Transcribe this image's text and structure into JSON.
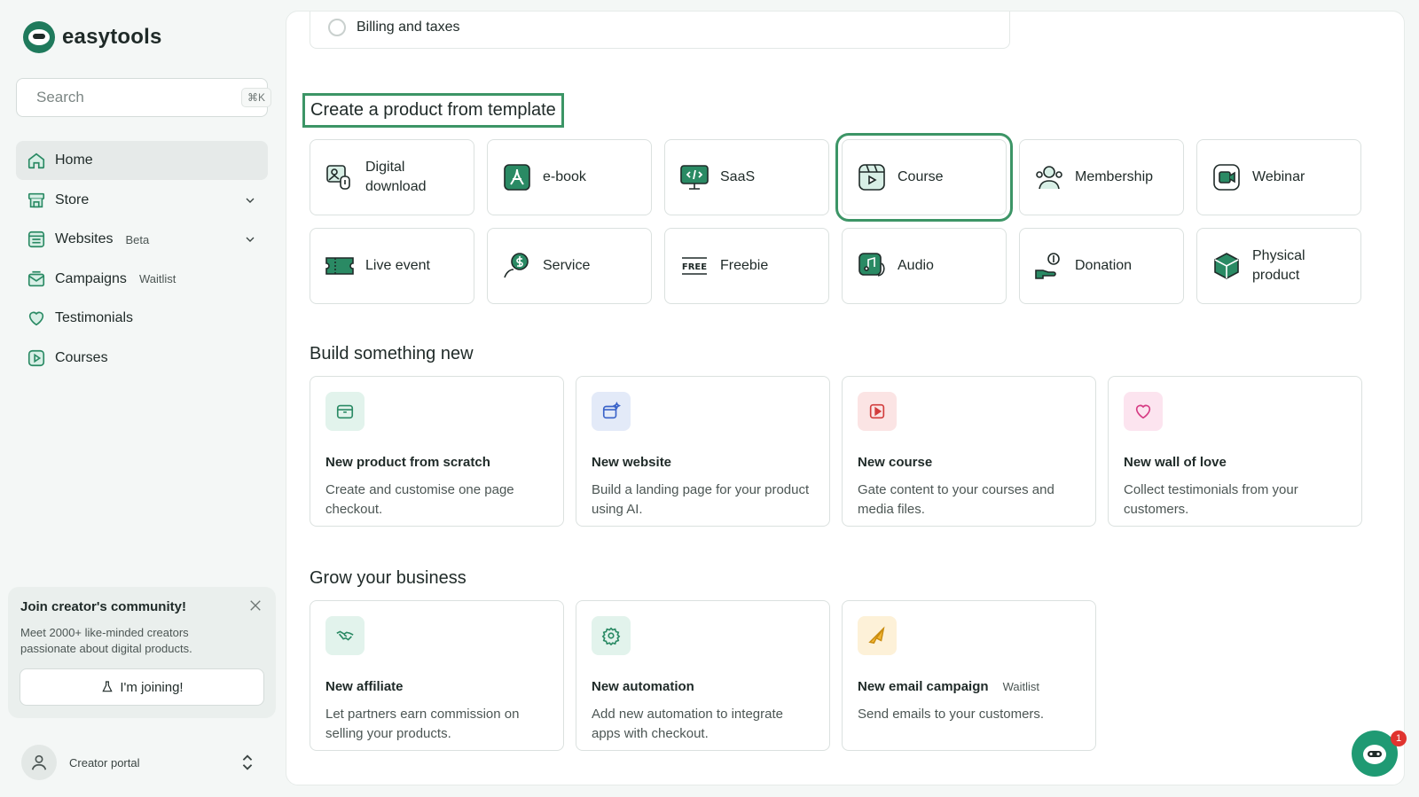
{
  "app": {
    "name": "easytools"
  },
  "search": {
    "placeholder": "Search",
    "shortcut": "⌘K"
  },
  "nav": {
    "items": [
      {
        "label": "Home",
        "badge": "",
        "icon": "home-icon"
      },
      {
        "label": "Store",
        "badge": "",
        "icon": "store-icon"
      },
      {
        "label": "Websites",
        "badge": "Beta",
        "icon": "websites-icon"
      },
      {
        "label": "Campaigns",
        "badge": "Waitlist",
        "icon": "campaigns-icon"
      },
      {
        "label": "Testimonials",
        "badge": "",
        "icon": "heart-icon"
      },
      {
        "label": "Courses",
        "badge": "",
        "icon": "play-icon"
      }
    ]
  },
  "community": {
    "title": "Join creator's community!",
    "text": "Meet 2000+ like-minded creators passionate about digital products.",
    "button": "I'm joining!"
  },
  "portal": {
    "label": "Creator portal"
  },
  "billing": {
    "label": "Billing and taxes"
  },
  "templates": {
    "title": "Create a product from template",
    "items": [
      {
        "label": "Digital download",
        "icon": "digital-download-icon"
      },
      {
        "label": "e-book",
        "icon": "ebook-icon"
      },
      {
        "label": "SaaS",
        "icon": "saas-icon"
      },
      {
        "label": "Course",
        "icon": "course-icon"
      },
      {
        "label": "Membership",
        "icon": "membership-icon"
      },
      {
        "label": "Webinar",
        "icon": "webinar-icon"
      },
      {
        "label": "Live event",
        "icon": "ticket-icon"
      },
      {
        "label": "Service",
        "icon": "service-icon"
      },
      {
        "label": "Freebie",
        "icon": "free-icon"
      },
      {
        "label": "Audio",
        "icon": "audio-icon"
      },
      {
        "label": "Donation",
        "icon": "donation-icon"
      },
      {
        "label": "Physical product",
        "icon": "box-icon"
      }
    ]
  },
  "build": {
    "title": "Build something new",
    "cards": [
      {
        "title": "New product from scratch",
        "badge": "",
        "desc": "Create and customise one page checkout."
      },
      {
        "title": "New website",
        "badge": "",
        "desc": "Build a landing page for your product using AI."
      },
      {
        "title": "New course",
        "badge": "",
        "desc": "Gate content to your courses and media files."
      },
      {
        "title": "New wall of love",
        "badge": "",
        "desc": "Collect testimonials from your customers."
      }
    ]
  },
  "grow": {
    "title": "Grow your business",
    "cards": [
      {
        "title": "New affiliate",
        "badge": "",
        "desc": "Let partners earn commission on selling your products."
      },
      {
        "title": "New automation",
        "badge": "",
        "desc": "Add new automation to integrate apps with checkout."
      },
      {
        "title": "New email campaign",
        "badge": "Waitlist",
        "desc": "Send emails to your customers."
      }
    ]
  },
  "chat": {
    "badge": "1"
  },
  "colors": {
    "accent": "#3c9566",
    "brand": "#1f7a5c",
    "notification": "#e0342f"
  }
}
